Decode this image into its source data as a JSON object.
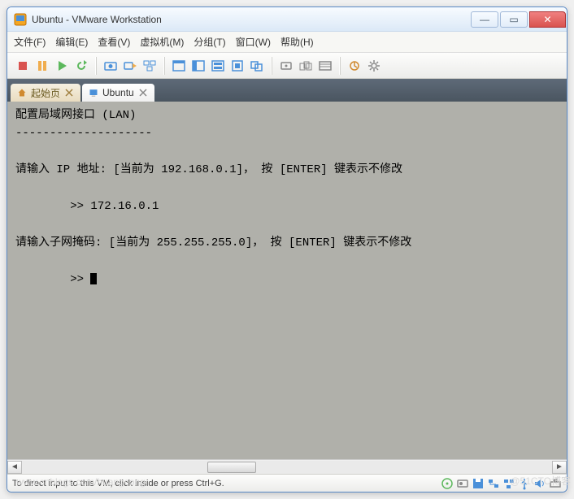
{
  "window": {
    "title": "Ubuntu - VMware Workstation"
  },
  "menu": {
    "file": "文件(F)",
    "edit": "编辑(E)",
    "view": "查看(V)",
    "vm": "虚拟机(M)",
    "tabs": "分组(T)",
    "windows": "窗口(W)",
    "help": "帮助(H)"
  },
  "tabs": {
    "home": "起始页",
    "ubuntu": "Ubuntu"
  },
  "console": {
    "line1": "配置局域网接口 (LAN)",
    "sep": "--------------------",
    "line2": "请输入 IP 地址: [当前为 192.168.0.1]， 按 [ENTER] 键表示不修改",
    "line3": "        >> 172.16.0.1",
    "line4": "请输入子网掩码: [当前为 255.255.255.0]， 按 [ENTER] 键表示不修改",
    "line5": "        >> "
  },
  "status": {
    "text": "To direct input to this VM, click inside or press Ctrl+G."
  },
  "watermark_left": "www.cnblogs.com/huangcong",
  "watermark_right": "@51CTO博客"
}
